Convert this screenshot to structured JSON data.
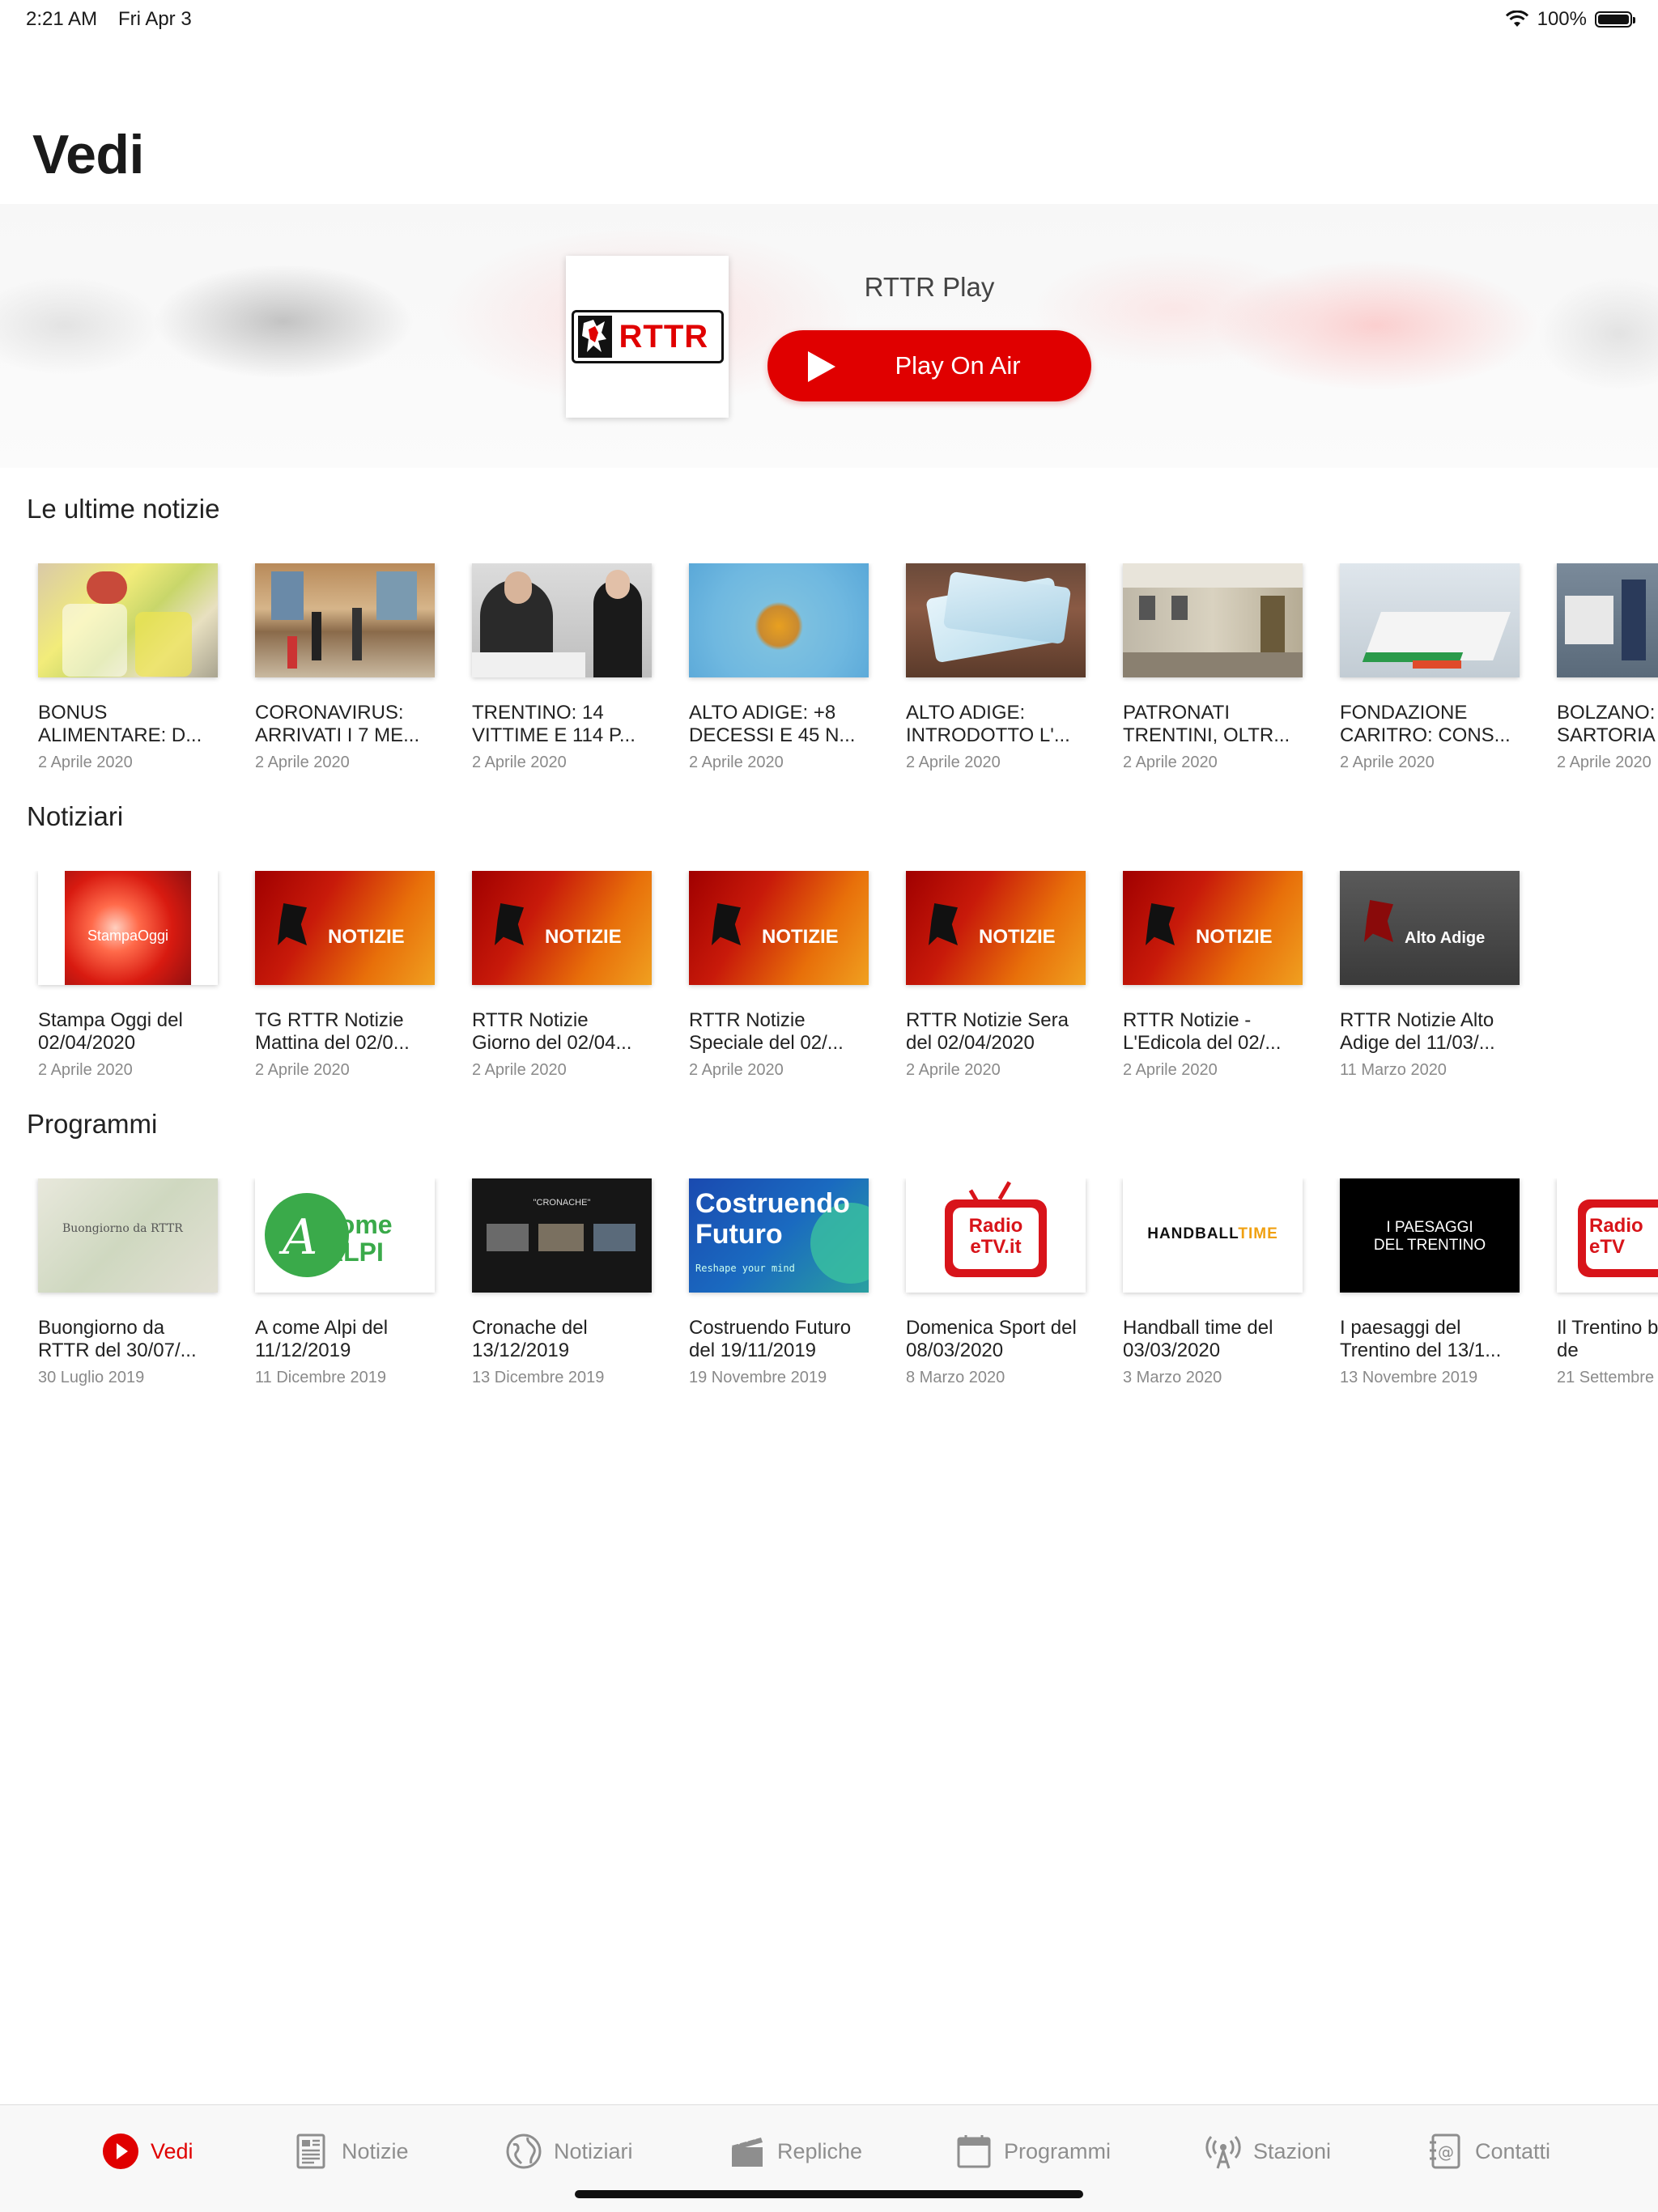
{
  "status": {
    "time": "2:21 AM",
    "date": "Fri Apr 3",
    "battery": "100%",
    "battery_level": 1.0
  },
  "page": {
    "title": "Vedi"
  },
  "hero": {
    "logo_text": "RTTR",
    "title": "RTTR Play",
    "play_label": "Play On Air"
  },
  "sections": {
    "news": {
      "title": "Le ultime notizie",
      "items": [
        {
          "title": "BONUS ALIMENTARE: D...",
          "date": "2 Aprile 2020"
        },
        {
          "title": "CORONAVIRUS: ARRIVATI I 7 ME...",
          "date": "2 Aprile 2020"
        },
        {
          "title": "TRENTINO: 14 VITTIME E 114 P...",
          "date": "2 Aprile 2020"
        },
        {
          "title": "ALTO ADIGE: +8 DECESSI E 45 N...",
          "date": "2 Aprile 2020"
        },
        {
          "title": "ALTO ADIGE: INTRODOTTO L'...",
          "date": "2 Aprile 2020"
        },
        {
          "title": "PATRONATI TRENTINI, OLTR...",
          "date": "2 Aprile 2020"
        },
        {
          "title": "FONDAZIONE CARITRO: CONS...",
          "date": "2 Aprile 2020"
        },
        {
          "title": "BOLZANO: SARTORIA",
          "date": "2 Aprile 2020"
        }
      ]
    },
    "newscasts": {
      "title": "Notiziari",
      "items": [
        {
          "title": "Stampa Oggi del 02/04/2020",
          "date": "2 Aprile 2020",
          "overlay": "StampaOggi"
        },
        {
          "title": "TG RTTR Notizie Mattina del 02/0...",
          "date": "2 Aprile 2020",
          "overlay": "NOTIZIE"
        },
        {
          "title": "RTTR Notizie Giorno del 02/04...",
          "date": "2 Aprile 2020",
          "overlay": "NOTIZIE"
        },
        {
          "title": "RTTR Notizie Speciale del 02/...",
          "date": "2 Aprile 2020",
          "overlay": "NOTIZIE"
        },
        {
          "title": "RTTR Notizie Sera del 02/04/2020",
          "date": "2 Aprile 2020",
          "overlay": "NOTIZIE"
        },
        {
          "title": "RTTR Notizie - L'Edicola del 02/...",
          "date": "2 Aprile 2020",
          "overlay": "NOTIZIE"
        },
        {
          "title": "RTTR Notizie Alto Adige del 11/03/...",
          "date": "11 Marzo 2020",
          "overlay": "Alto Adige"
        }
      ]
    },
    "programs": {
      "title": "Programmi",
      "items": [
        {
          "title": "Buongiorno da RTTR del 30/07/...",
          "date": "30 Luglio 2019",
          "overlay": "Buongiorno da RTTR"
        },
        {
          "title": "A come Alpi del 11/12/2019",
          "date": "11 Dicembre 2019",
          "overlay": "come ALPI"
        },
        {
          "title": "Cronache del 13/12/2019",
          "date": "13 Dicembre 2019",
          "overlay": "\"CRONACHE\""
        },
        {
          "title": "Costruendo Futuro del 19/11/2019",
          "date": "19 Novembre 2019",
          "overlay": "Costruendo Futuro",
          "overlay_sub": "Reshape your mind"
        },
        {
          "title": "Domenica Sport del 08/03/2020",
          "date": "8 Marzo 2020",
          "overlay": "Radio eTV.it"
        },
        {
          "title": "Handball time del 03/03/2020",
          "date": "3 Marzo 2020",
          "overlay": "HANDBALL",
          "overlay_accent": "TIME"
        },
        {
          "title": "I paesaggi del Trentino del 13/1...",
          "date": "13 Novembre 2019",
          "overlay": "I PAESAGGI DEL TRENTINO"
        },
        {
          "title": "Il Trentino bambini de",
          "date": "21 Settembre",
          "overlay": "Radio eTV"
        }
      ]
    }
  },
  "tabs": [
    {
      "label": "Vedi",
      "icon": "play-circle-icon"
    },
    {
      "label": "Notizie",
      "icon": "newspaper-icon"
    },
    {
      "label": "Notiziari",
      "icon": "globe-icon"
    },
    {
      "label": "Repliche",
      "icon": "clapperboard-icon"
    },
    {
      "label": "Programmi",
      "icon": "calendar-icon"
    },
    {
      "label": "Stazioni",
      "icon": "antenna-icon"
    },
    {
      "label": "Contatti",
      "icon": "address-book-icon"
    }
  ],
  "colors": {
    "accent": "#e00000",
    "tab_inactive": "#8e8e8e"
  }
}
